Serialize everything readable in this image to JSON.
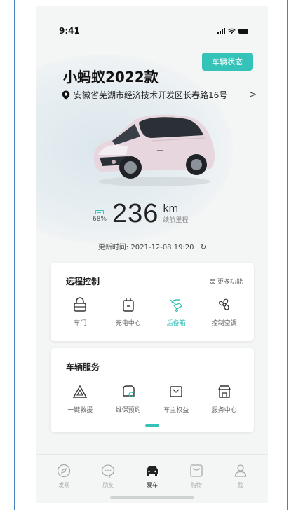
{
  "status_bar": {
    "time": "9:41"
  },
  "header": {
    "vehicle_status_button": "车辆状态",
    "title": "小蚂蚁2022款",
    "address": "安徽省芜湖市经济技术开发区长春路16号",
    "chevron": ">"
  },
  "range": {
    "battery_percent": "68",
    "battery_unit": "%",
    "value": "236",
    "unit": "km",
    "sub_label": "续航里程"
  },
  "updated": {
    "label": "更新时间: 2021-12-08 19:20"
  },
  "remote_control": {
    "title": "远程控制",
    "more_label": "更多功能",
    "items": [
      {
        "label": "车门",
        "icon": "car-door-icon"
      },
      {
        "label": "充电中心",
        "icon": "charging-icon"
      },
      {
        "label": "后备箱",
        "icon": "trunk-icon"
      },
      {
        "label": "控制空调",
        "icon": "ac-fan-icon"
      }
    ]
  },
  "vehicle_service": {
    "title": "车辆服务",
    "items": [
      {
        "label": "一键救援",
        "icon": "rescue-icon"
      },
      {
        "label": "维保预约",
        "icon": "maintenance-icon"
      },
      {
        "label": "车主权益",
        "icon": "owner-rights-icon"
      },
      {
        "label": "服务中心",
        "icon": "service-center-icon"
      }
    ]
  },
  "tabbar": {
    "items": [
      {
        "label": "发现",
        "icon": "discover-icon"
      },
      {
        "label": "朋友",
        "icon": "chat-icon"
      },
      {
        "label": "爱车",
        "icon": "car-icon"
      },
      {
        "label": "购物",
        "icon": "shop-icon"
      },
      {
        "label": "我",
        "icon": "profile-icon"
      }
    ]
  },
  "colors": {
    "accent": "#35c2b8",
    "car_body": "#e8d6de"
  }
}
